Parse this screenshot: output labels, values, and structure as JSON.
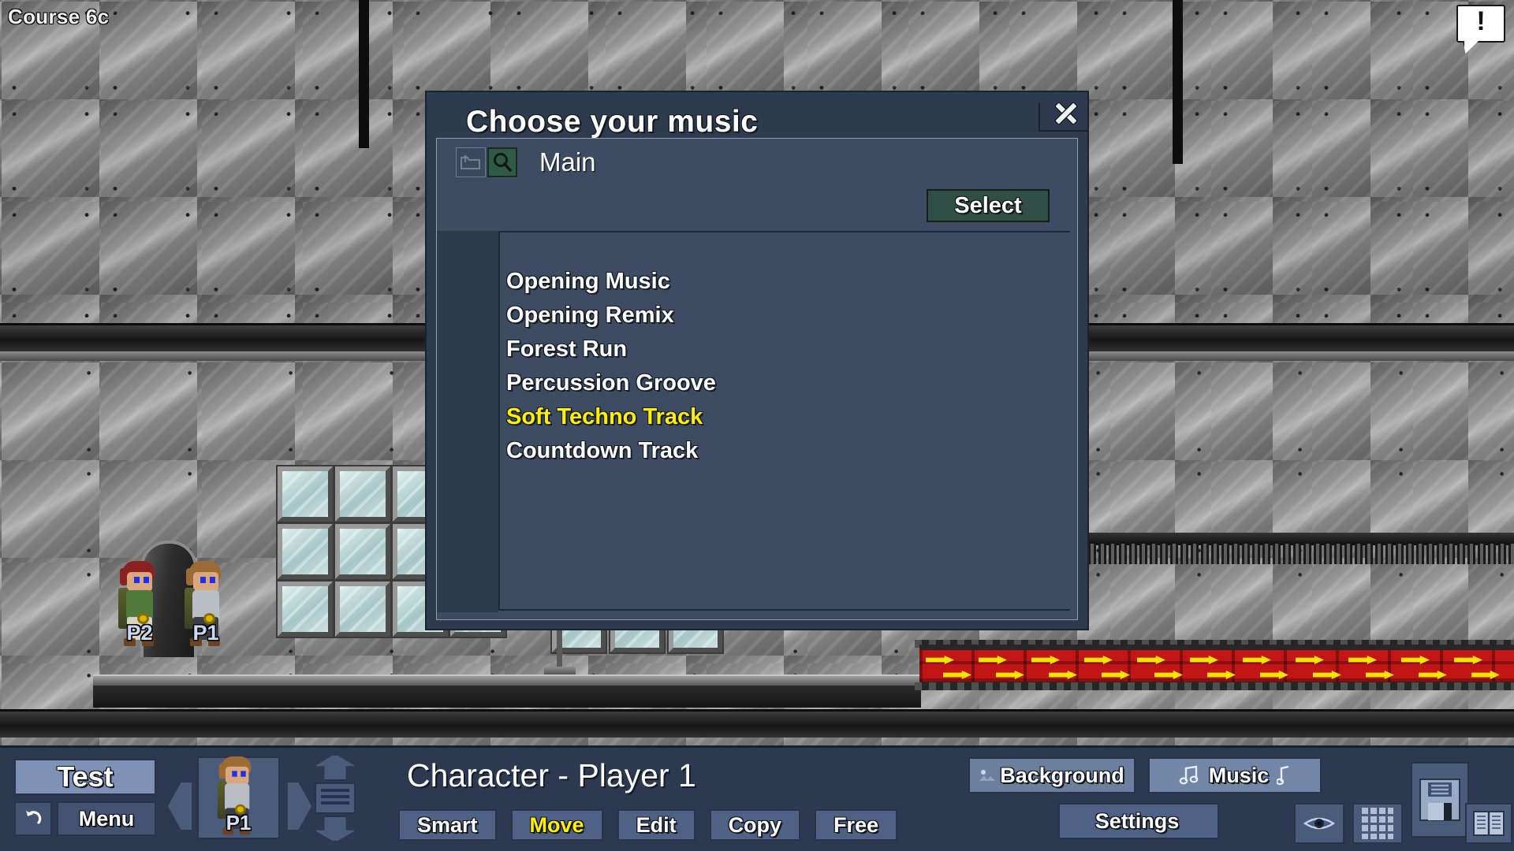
{
  "hud": {
    "course_label": "Course 6c"
  },
  "world": {
    "players": [
      {
        "tag": "P2",
        "hair_color": "#8c1f1f",
        "shirt_color": "#4f7a3a"
      },
      {
        "tag": "P1",
        "hair_color": "#9b6a35",
        "shirt_color": "#b9bdc4"
      }
    ],
    "conveyor": {
      "color": "#c21515",
      "arrow_color": "#f5e400",
      "direction": "right",
      "arrow_count": 22
    }
  },
  "dialog": {
    "title": "Choose your music",
    "close_icon": "close-icon",
    "path_bar": {
      "up_folder_icon": "up-folder-icon",
      "search_icon": "search-icon",
      "search_active": true,
      "path": "Main"
    },
    "select_label": "Select",
    "tracks": [
      {
        "label": "Opening Music",
        "selected": false
      },
      {
        "label": "Opening Remix",
        "selected": false
      },
      {
        "label": "Forest Run",
        "selected": false
      },
      {
        "label": "Percussion Groove",
        "selected": false
      },
      {
        "label": "Soft Techno Track",
        "selected": true
      },
      {
        "label": "Countdown Track",
        "selected": false
      }
    ],
    "selected_color": "#ffef00"
  },
  "toolbar": {
    "test_label": "Test",
    "undo_icon": "undo-icon",
    "menu_label": "Menu",
    "prev_icon": "chevron-left-icon",
    "next_icon": "chevron-right-icon",
    "portrait_tag": "P1",
    "layer_icon": "layer-stack-icon",
    "main_title": "Character - Player 1",
    "modes": [
      {
        "label": "Smart",
        "active": false
      },
      {
        "label": "Move",
        "active": true
      },
      {
        "label": "Edit",
        "active": false
      },
      {
        "label": "Copy",
        "active": false
      },
      {
        "label": "Free",
        "active": false
      }
    ],
    "background_label": "Background",
    "background_icon": "landscape-icon",
    "music_label": "Music",
    "music_icon_left": "music-notes-icon",
    "music_icon_right": "music-note-icon",
    "settings_label": "Settings",
    "settings_icon": "wrench-icon",
    "eye_icon": "eye-icon",
    "grid_icon": "grid-icon",
    "save_icon": "floppy-save-icon",
    "book_icon": "book-icon",
    "alert_icon": "alert-bubble-icon",
    "alert_text": "!"
  }
}
